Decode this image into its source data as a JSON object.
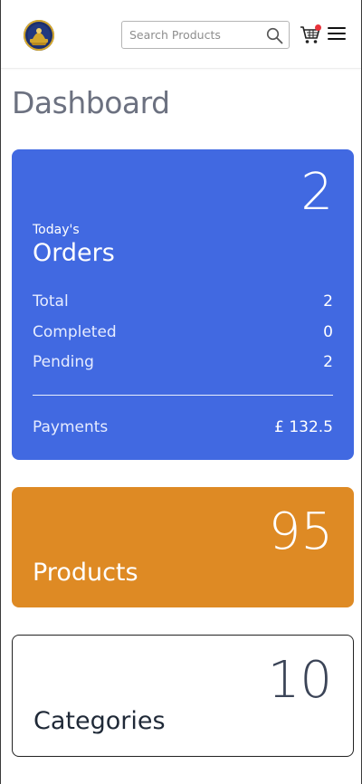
{
  "header": {
    "search": {
      "placeholder": "Search Products",
      "value": ""
    },
    "icons": {
      "logo": "brand-logo-emblem",
      "search": "magnifier-icon",
      "cart": "shopping-cart-icon",
      "menu": "hamburger-menu-icon"
    },
    "cart_badge_color": "#e8323a"
  },
  "page": {
    "title": "Dashboard"
  },
  "orders_card": {
    "count": "2",
    "subtitle": "Today's",
    "title": "Orders",
    "stats": [
      {
        "label": "Total",
        "value": "2"
      },
      {
        "label": "Completed",
        "value": "0"
      },
      {
        "label": "Pending",
        "value": "2"
      }
    ],
    "payments_label": "Payments",
    "payments_value": "£ 132.5",
    "color": "#4169e1"
  },
  "products_card": {
    "count": "95",
    "title": "Products",
    "color": "#de8a24"
  },
  "categories_card": {
    "count": "10",
    "title": "Categories",
    "color": "#ffffff"
  }
}
